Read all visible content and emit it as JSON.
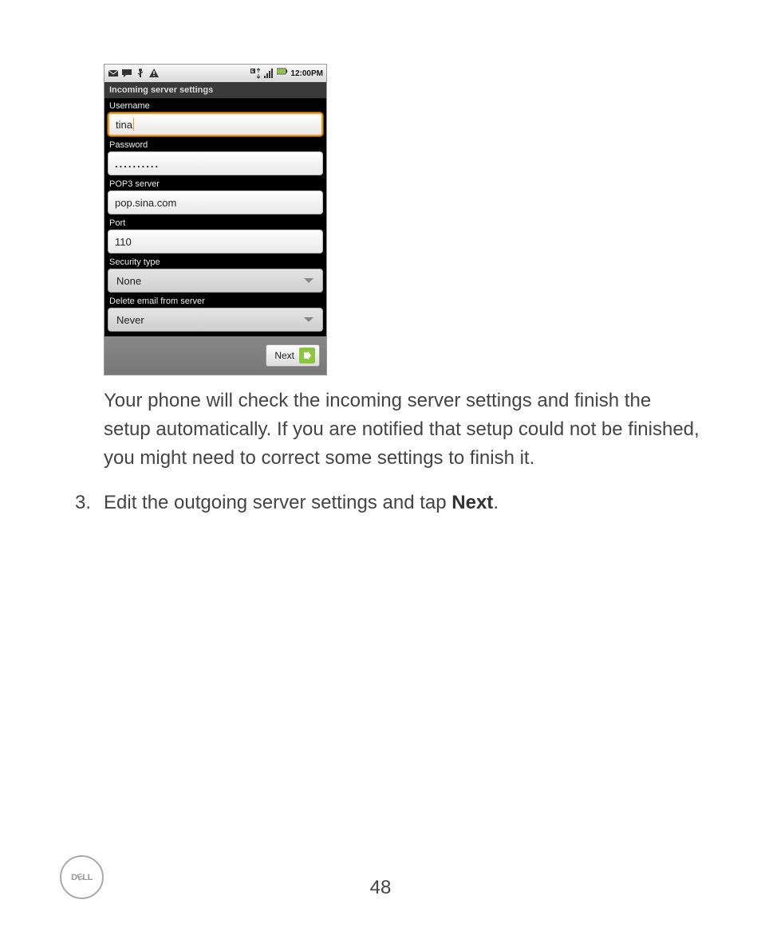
{
  "statusbar": {
    "time": "12:00PM"
  },
  "screen": {
    "title": "Incoming server settings",
    "fields": {
      "username_label": "Username",
      "username_value": "tina",
      "password_label": "Password",
      "password_value": "..........",
      "pop3_label": "POP3 server",
      "pop3_value": "pop.sina.com",
      "port_label": "Port",
      "port_value": "110",
      "security_label": "Security type",
      "security_value": "None",
      "delete_label": "Delete email from server",
      "delete_value": "Never"
    },
    "next_button": "Next"
  },
  "paragraph": "Your phone will check the incoming server settings and finish the setup automatically. If you are notified that setup could not be finished, you might need to correct some settings to finish it.",
  "step3": {
    "num": "3.",
    "prefix": "Edit the outgoing server settings and tap ",
    "bold": "Next",
    "suffix": "."
  },
  "page_number": "48",
  "logo_text": "DELL"
}
